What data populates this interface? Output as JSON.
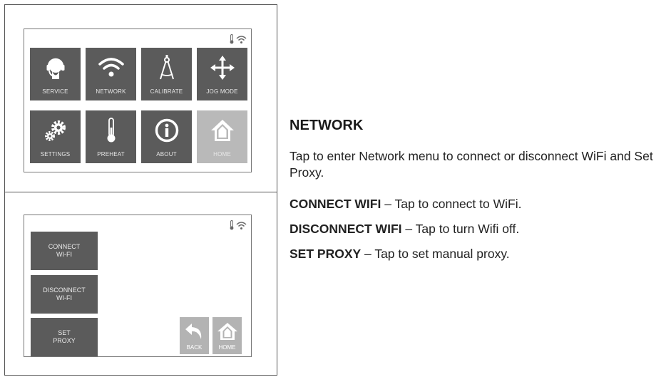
{
  "top_screen": {
    "tiles": [
      {
        "label": "SERVICE",
        "icon": "headset-icon"
      },
      {
        "label": "NETWORK",
        "icon": "wifi-icon"
      },
      {
        "label": "CALIBRATE",
        "icon": "compass-icon"
      },
      {
        "label": "JOG MODE",
        "icon": "move-arrows-icon"
      },
      {
        "label": "SETTINGS",
        "icon": "gears-icon"
      },
      {
        "label": "PREHEAT",
        "icon": "thermometer-icon"
      },
      {
        "label": "ABOUT",
        "icon": "info-icon"
      },
      {
        "label": "HOME",
        "icon": "home-icon"
      }
    ]
  },
  "network_screen": {
    "connect": {
      "line1": "CONNECT",
      "line2": "WI-FI"
    },
    "disconnect": {
      "line1": "DISCONNECT",
      "line2": "WI-FI"
    },
    "proxy": {
      "line1": "SET",
      "line2": "PROXY"
    },
    "back_label": "BACK",
    "home_label": "HOME"
  },
  "description": {
    "title": "NETWORK",
    "intro": "Tap to enter Network menu to connect or disconnect WiFi and Set Proxy.",
    "items": [
      {
        "term": "CONNECT WIFI",
        "text": " – Tap to connect to WiFi."
      },
      {
        "term": "DISCONNECT WIFI",
        "text": " – Tap to turn Wifi off."
      },
      {
        "term": "SET PROXY",
        "text": " – Tap to set manual proxy."
      }
    ]
  },
  "colors": {
    "tile": "#5b5b5b",
    "tile_home": "#b9b9b9",
    "nav_button": "#b3b3b3"
  }
}
